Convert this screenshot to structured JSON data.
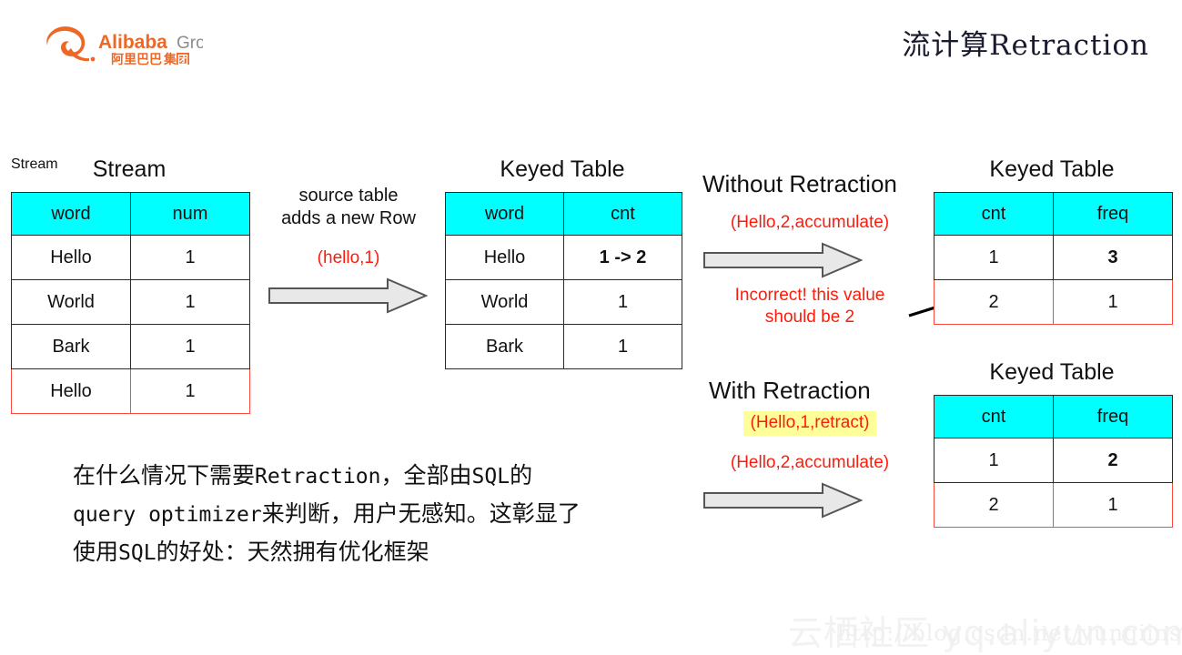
{
  "header": {
    "logo_name": "alibaba-group-logo",
    "logo_text_en": "Alibaba Group",
    "logo_text_cn": "阿里巴巴集团",
    "title": "流计算Retraction"
  },
  "colors": {
    "header_cyan": "#00ffff",
    "highlight_red": "#fc1c0c",
    "red_border": "#fb4a3a",
    "highlight_yellow": "#ffff99",
    "arrow_fill": "#e8e8e8",
    "arrow_stroke": "#555555",
    "brand_orange": "#ef6724"
  },
  "stream_table": {
    "title": "Stream",
    "columns": [
      "word",
      "num"
    ],
    "rows": [
      {
        "cells": [
          "Hello",
          "1"
        ],
        "highlight": false
      },
      {
        "cells": [
          "World",
          "1"
        ],
        "highlight": false
      },
      {
        "cells": [
          "Bark",
          "1"
        ],
        "highlight": false
      },
      {
        "cells": [
          "Hello",
          "1"
        ],
        "highlight": true
      }
    ]
  },
  "source_arrow": {
    "line1": "source table",
    "line2": "adds a new Row",
    "event": "(hello,1)",
    "icon": "right-arrow-icon"
  },
  "keyed_table_mid": {
    "title": "Keyed Table",
    "columns": [
      "word",
      "cnt"
    ],
    "rows": [
      {
        "cells": [
          "Hello",
          "1 -> 2"
        ],
        "red_value": true
      },
      {
        "cells": [
          "World",
          "1"
        ],
        "red_value": false
      },
      {
        "cells": [
          "Bark",
          "1"
        ],
        "red_value": false
      }
    ]
  },
  "without_retraction": {
    "title": "Without Retraction",
    "event": "(Hello,2,accumulate)",
    "icon": "right-arrow-icon",
    "note_line1": "Incorrect! this value",
    "note_line2": "should be 2",
    "pointer_icon": "pointer-arrow-icon"
  },
  "keyed_table_top_right": {
    "title": "Keyed Table",
    "columns": [
      "cnt",
      "freq"
    ],
    "rows": [
      {
        "cells": [
          "1",
          "3"
        ],
        "red_value": true,
        "highlight": false
      },
      {
        "cells": [
          "2",
          "1"
        ],
        "red_value": false,
        "highlight": true
      }
    ]
  },
  "with_retraction": {
    "title": "With Retraction",
    "event_retract": "(Hello,1,retract)",
    "event_accumulate": "(Hello,2,accumulate)",
    "icon": "right-arrow-icon"
  },
  "keyed_table_bottom_right": {
    "title": "Keyed Table",
    "columns": [
      "cnt",
      "freq"
    ],
    "rows": [
      {
        "cells": [
          "1",
          "2"
        ],
        "red_value": true,
        "highlight": false
      },
      {
        "cells": [
          "2",
          "1"
        ],
        "red_value": false,
        "highlight": true
      }
    ]
  },
  "body_text": {
    "line1_a": "在什么情况下需要",
    "line1_b": "Retraction",
    "line1_c": "，全部由",
    "line1_d": "SQL",
    "line1_e": "的",
    "line2_a": "query optimizer",
    "line2_b": "来判断，用户无感知。这彰显了",
    "line3_a": "使用",
    "line3_b": "SQL",
    "line3_c": "的好处：天然拥有优化框架"
  },
  "watermark": {
    "cn": "云栖社区 yq.aliyun.com",
    "url": "http://blog.csdn.net/yunqiinsight"
  }
}
